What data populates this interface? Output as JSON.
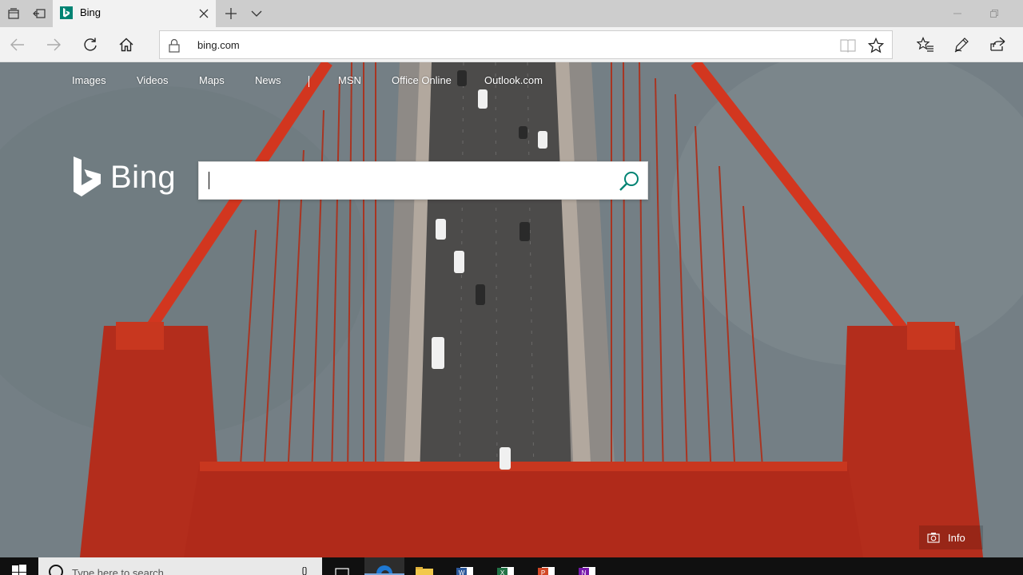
{
  "browser": {
    "tab": {
      "title": "Bing",
      "favicon": "bing-b-icon"
    },
    "address": {
      "url": "bing.com"
    }
  },
  "page": {
    "nav_links": [
      "Images",
      "Videos",
      "Maps",
      "News",
      "MSN",
      "Office Online",
      "Outlook.com"
    ],
    "logo_text": "Bing",
    "search": {
      "value": "",
      "placeholder": ""
    },
    "info_label": "Info"
  },
  "taskbar": {
    "search_placeholder": "Type here to search",
    "apps": [
      "task-view-icon",
      "edge-icon",
      "file-explorer-icon",
      "word-icon",
      "excel-icon",
      "powerpoint-icon",
      "onenote-icon"
    ]
  },
  "colors": {
    "bing_teal": "#008373",
    "bridge_red": "#c0301f",
    "taskbar": "#101010"
  }
}
